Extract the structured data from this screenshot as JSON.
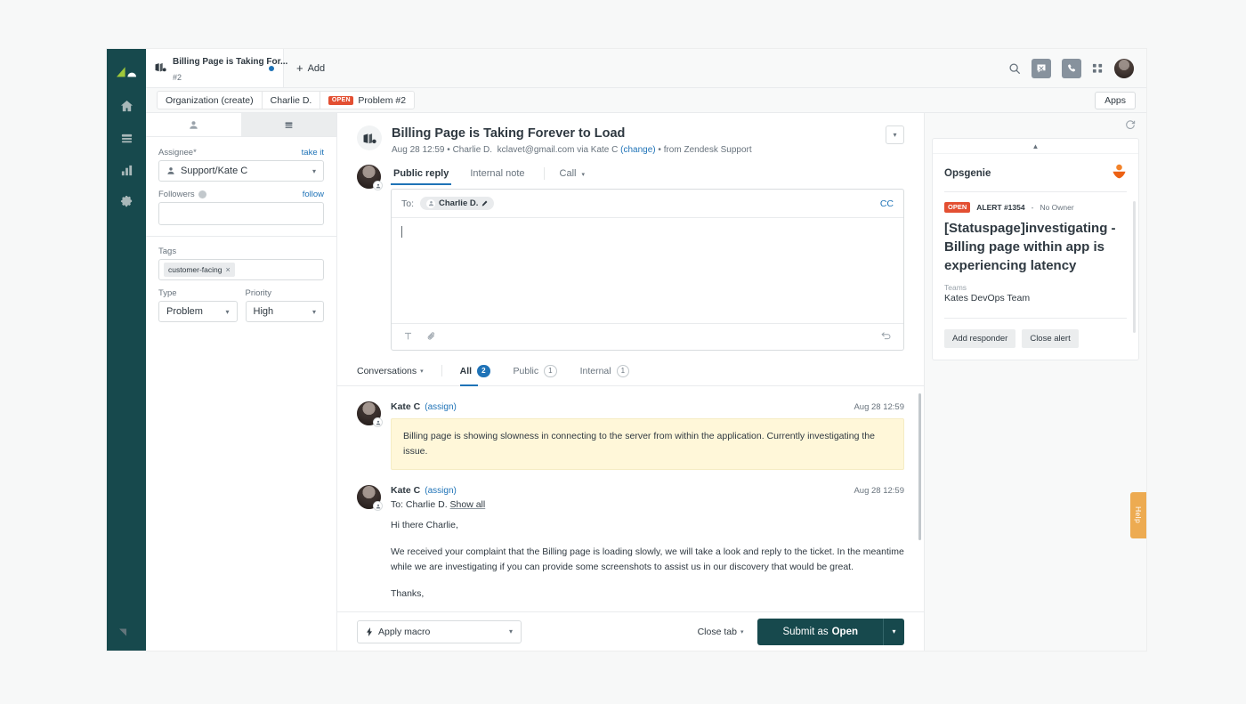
{
  "rail": {
    "logo": "zendesk-logo",
    "items": [
      {
        "name": "home",
        "icon": "home-icon"
      },
      {
        "name": "views",
        "icon": "views-icon"
      },
      {
        "name": "reporting",
        "icon": "chart-bars-icon"
      },
      {
        "name": "admin",
        "icon": "gear-icon"
      }
    ],
    "bottom_logo": "zendesk-z-logo"
  },
  "topbar": {
    "ticket_tab": {
      "title": "Billing Page is Taking For...",
      "number": "#2",
      "unread_dot": true
    },
    "add_label": "Add",
    "icons": [
      "search-icon",
      "chat-off-icon",
      "talk-icon",
      "products-grid-icon",
      "user-avatar"
    ]
  },
  "breadcrumb": {
    "items": [
      {
        "label": "Organization (create)",
        "badge": null
      },
      {
        "label": "Charlie D.",
        "badge": null
      },
      {
        "label": "Problem #2",
        "badge": "OPEN"
      }
    ],
    "apps_label": "Apps"
  },
  "properties": {
    "tabs": [
      {
        "name": "user-tab",
        "icon": "user-icon",
        "active": true
      },
      {
        "name": "ticket-tab",
        "icon": "ticket-icon",
        "active": false
      }
    ],
    "assignee": {
      "label": "Assignee*",
      "action": "take it",
      "value": "Support/Kate C"
    },
    "followers": {
      "label": "Followers",
      "action": "follow",
      "value": ""
    },
    "tags": {
      "label": "Tags",
      "items": [
        "customer-facing"
      ]
    },
    "type": {
      "label": "Type",
      "value": "Problem"
    },
    "priority": {
      "label": "Priority",
      "value": "High"
    }
  },
  "ticket": {
    "title": "Billing Page is Taking Forever to Load",
    "meta_date": "Aug 28 12:59",
    "meta_sep1": "•",
    "meta_requester": "Charlie D.",
    "meta_email": "kclavet@gmail.com via Kate C",
    "meta_change": "(change)",
    "meta_sep2": "•",
    "meta_channel": "from Zendesk Support"
  },
  "composer": {
    "tabs": [
      {
        "label": "Public reply",
        "active": true
      },
      {
        "label": "Internal note",
        "active": false
      },
      {
        "label": "Call",
        "active": false,
        "caret": true
      }
    ],
    "to_label": "To:",
    "to_recipient": "Charlie D.",
    "cc_label": "CC",
    "body_value": "",
    "toolbar": [
      "text-format-icon",
      "attachment-icon",
      "undo-icon"
    ]
  },
  "conversation_filter": {
    "label": "Conversations",
    "items": [
      {
        "label": "All",
        "count": "2",
        "active": true
      },
      {
        "label": "Public",
        "count": "1",
        "active": false
      },
      {
        "label": "Internal",
        "count": "1",
        "active": false
      }
    ]
  },
  "comments": [
    {
      "author": "Kate C",
      "assign_link": "(assign)",
      "time": "Aug 28 12:59",
      "to_line": null,
      "show_all": null,
      "is_note": true,
      "paragraphs": [
        "Billing page is showing slowness in connecting to the server from within the application. Currently investigating the issue."
      ]
    },
    {
      "author": "Kate C",
      "assign_link": "(assign)",
      "time": "Aug 28 12:59",
      "to_line": "To: Charlie D.",
      "show_all": "Show all",
      "is_note": false,
      "paragraphs": [
        "Hi there Charlie,",
        "We received your complaint that the Billing page is loading slowly, we will take a look and reply to the ticket. In the meantime while we are investigating if you can provide some screenshots to assist us in our discovery that would be great.",
        "Thanks,"
      ]
    }
  ],
  "bottombar": {
    "macro_label": "Apply macro",
    "close_tab_label": "Close tab",
    "submit_prefix": "Submit as",
    "submit_status": "Open"
  },
  "apps_panel": {
    "refresh_icon": "refresh-icon",
    "collapse_icon": "chevron-up-icon",
    "title": "Opsgenie",
    "logo": "opsgenie-logo",
    "alert": {
      "status": "OPEN",
      "id": "ALERT #1354",
      "separator": "-",
      "owner": "No Owner",
      "title": "[Statuspage]investigating - Billing page within app is experiencing latency",
      "teams_label": "Teams",
      "teams_value": "Kates DevOps Team",
      "actions": [
        "Add responder",
        "Close alert"
      ]
    }
  },
  "help_tab": {
    "label": "Help"
  },
  "colors": {
    "brand_dark": "#17494d",
    "accent_blue": "#1f73b7",
    "status_open": "#e34f32",
    "note_bg": "#fff7d9",
    "opsgenie_orange": "#f2832a",
    "help_orange": "#edab51"
  }
}
